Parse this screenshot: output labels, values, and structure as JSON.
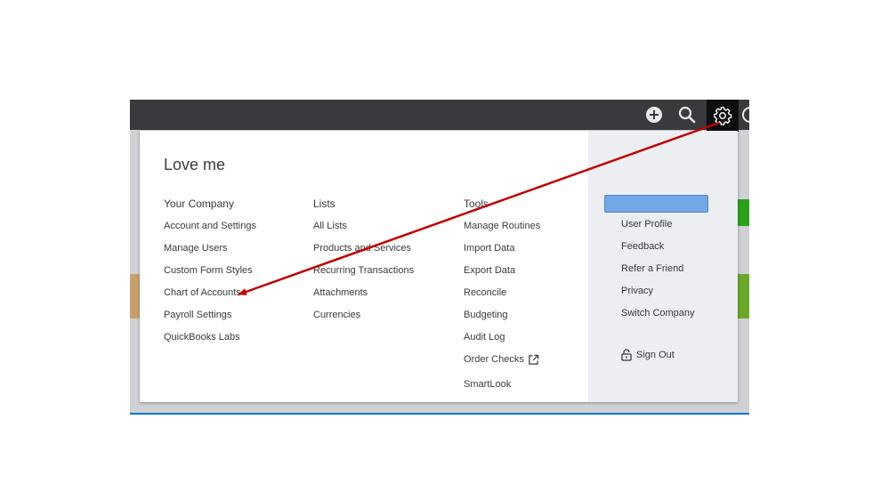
{
  "company_name": "Love me",
  "your_company": {
    "heading": "Your Company",
    "items": [
      "Account and Settings",
      "Manage Users",
      "Custom Form Styles",
      "Chart of Accounts",
      "Payroll Settings",
      "QuickBooks Labs"
    ]
  },
  "lists": {
    "heading": "Lists",
    "items": [
      "All Lists",
      "Products and Services",
      "Recurring Transactions",
      "Attachments",
      "Currencies"
    ]
  },
  "tools": {
    "heading": "Tools",
    "items": [
      "Manage Routines",
      "Import Data",
      "Export Data",
      "Reconcile",
      "Budgeting",
      "Audit Log",
      "Order Checks",
      "SmartLook"
    ]
  },
  "profile": {
    "items": [
      "User Profile",
      "Feedback",
      "Refer a Friend",
      "Privacy",
      "Switch Company"
    ],
    "sign_out": "Sign Out"
  },
  "topbar_icons": [
    "plus-icon",
    "search-icon",
    "gear-icon",
    "clock-icon"
  ],
  "colors": {
    "topbar": "#393a3d",
    "gear_active": "#0d0e10",
    "profile_button": "#74a7e6",
    "right_column": "#eceef1",
    "annotation_arrow": "#c00000",
    "green_accent": "#2ca01c"
  }
}
